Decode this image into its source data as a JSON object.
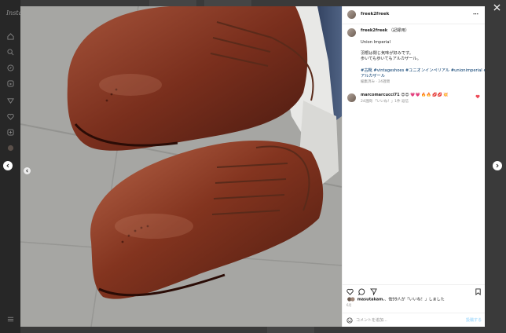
{
  "background": {
    "app_logo": "Insta"
  },
  "header": {
    "username": "freek2freek",
    "more_icon": "more-horizontal-icon"
  },
  "caption": {
    "username": "freek2freek",
    "edited_label": "（記録用）",
    "lines": [
      "Union Imperial",
      "",
      "羽根は閉じ気味が好みです。",
      "歩いても歩いてもアルカザール。",
      "",
      "#古靴 #vintageshoes #ユニオンインペリアル #unionimperial #",
      "アルカザール"
    ],
    "meta": "編集済み · 24週間"
  },
  "comment": {
    "username": "marcomarcucci71",
    "text": "😍😍 💗💗 🔥🔥 💋💋 💥",
    "meta": "24週間 「いいね！」1件 返信"
  },
  "likes": {
    "user": "masutakam.",
    "text": "、他99人が「いいね！」しました"
  },
  "date": "6月",
  "add_comment": {
    "placeholder": "コメントを追加...",
    "post_label": "投稿する"
  },
  "colors": {
    "link": "#00376b",
    "post_button": "#b2dffc",
    "shoe_leather": "#6e2a1a"
  }
}
